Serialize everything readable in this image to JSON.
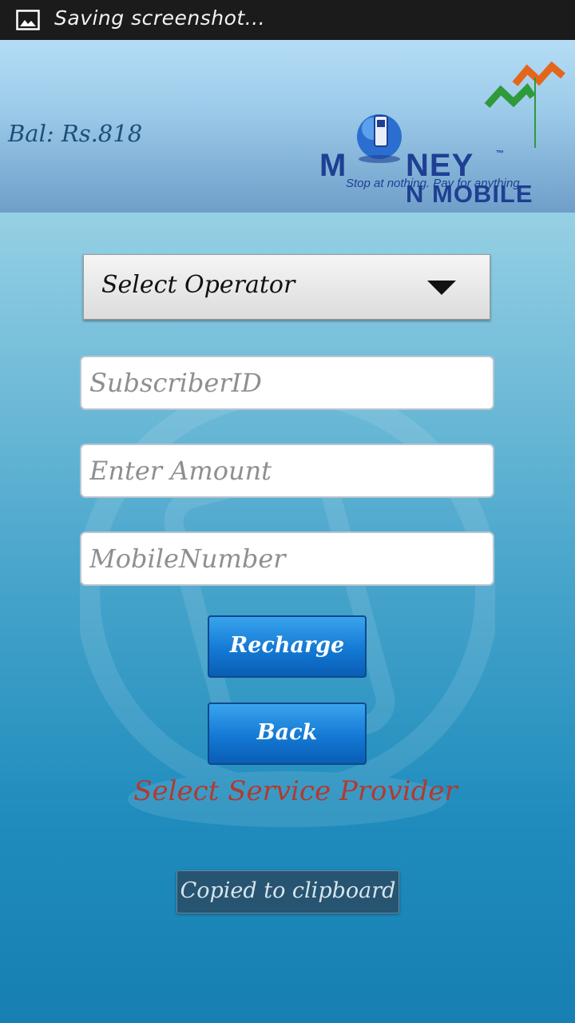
{
  "statusbar": {
    "icon": "image-icon",
    "text": "Saving screenshot..."
  },
  "header": {
    "balance": "Bal: Rs.818",
    "logo": {
      "word1_prefix": "M",
      "word1_suffix": "NEY",
      "word2": "N MOBILE",
      "tagline": "Stop at nothing. Pay for anything.",
      "tm": "™"
    }
  },
  "form": {
    "operator_select": {
      "label": "Select Operator"
    },
    "subscriber_id": {
      "placeholder": "SubscriberID"
    },
    "amount": {
      "placeholder": "Enter Amount"
    },
    "mobile_number": {
      "placeholder": "MobileNumber"
    },
    "recharge_label": "Recharge",
    "back_label": "Back"
  },
  "error_message": "Select Service Provider",
  "toast": "Copied to clipboard",
  "colors": {
    "brand_blue": "#1f3f93",
    "button_blue": "#1379d4",
    "error_red": "#b23a30",
    "logo_orange": "#e4661c",
    "logo_green": "#2f9a3a"
  }
}
